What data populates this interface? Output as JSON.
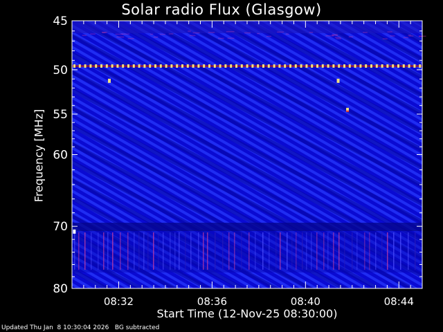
{
  "chart_data": {
    "type": "heatmap",
    "title": "Solar radio Flux (Glasgow)",
    "xlabel": "Start Time (12-Nov-25 08:30:00)",
    "ylabel": "Frequency [MHz]",
    "x_ticks": [
      "08:32",
      "08:36",
      "08:40",
      "08:44"
    ],
    "x_tick_minutes": [
      2,
      6,
      10,
      14
    ],
    "x_range_minutes": [
      0,
      15
    ],
    "y_ticks": [
      45,
      50,
      55,
      60,
      70,
      80
    ],
    "y_range": [
      45,
      80
    ],
    "y_scale": "log",
    "colors": {
      "background": "#0a0ad2",
      "interference": "#f0e080"
    },
    "features": [
      {
        "type": "interference-line",
        "freq_mhz": 49.6
      },
      {
        "type": "spot",
        "minute": 1.6,
        "freq_mhz": 51.2
      },
      {
        "type": "spot",
        "minute": 11.4,
        "freq_mhz": 51.2
      },
      {
        "type": "spot",
        "minute": 11.8,
        "freq_mhz": 54.5
      },
      {
        "type": "spot",
        "minute": 0.1,
        "freq_mhz": 70.8
      }
    ]
  },
  "footer": {
    "updated": "Updated Thu Jan  8 10:30:04 2026",
    "note": "BG subtracted"
  }
}
